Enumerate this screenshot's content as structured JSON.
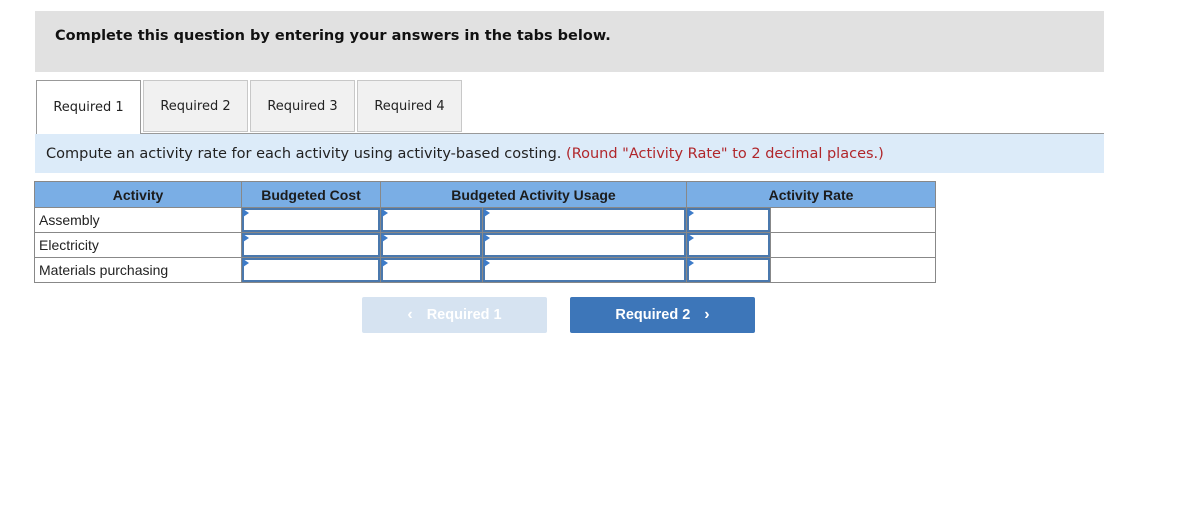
{
  "instructions": "Complete this question by entering your answers in the tabs below.",
  "tabs": [
    {
      "label": "Required 1",
      "active": true
    },
    {
      "label": "Required 2",
      "active": false
    },
    {
      "label": "Required 3",
      "active": false
    },
    {
      "label": "Required 4",
      "active": false
    }
  ],
  "prompt": {
    "text": "Compute an activity rate for each activity using activity-based costing.",
    "note": "(Round \"Activity Rate\" to 2 decimal places.)"
  },
  "table": {
    "headers": [
      "Activity",
      "Budgeted Cost",
      "Budgeted Activity Usage",
      "Activity Rate"
    ],
    "rows": [
      {
        "activity": "Assembly",
        "budgeted_cost": "",
        "usage_amount": "",
        "usage_unit": "",
        "rate": "",
        "rate_unit": ""
      },
      {
        "activity": "Electricity",
        "budgeted_cost": "",
        "usage_amount": "",
        "usage_unit": "",
        "rate": "",
        "rate_unit": ""
      },
      {
        "activity": "Materials purchasing",
        "budgeted_cost": "",
        "usage_amount": "",
        "usage_unit": "",
        "rate": "",
        "rate_unit": ""
      }
    ]
  },
  "nav": {
    "prev_label": "Required 1",
    "prev_icon": "chevron-left-icon",
    "next_label": "Required 2",
    "next_icon": "chevron-right-icon"
  }
}
